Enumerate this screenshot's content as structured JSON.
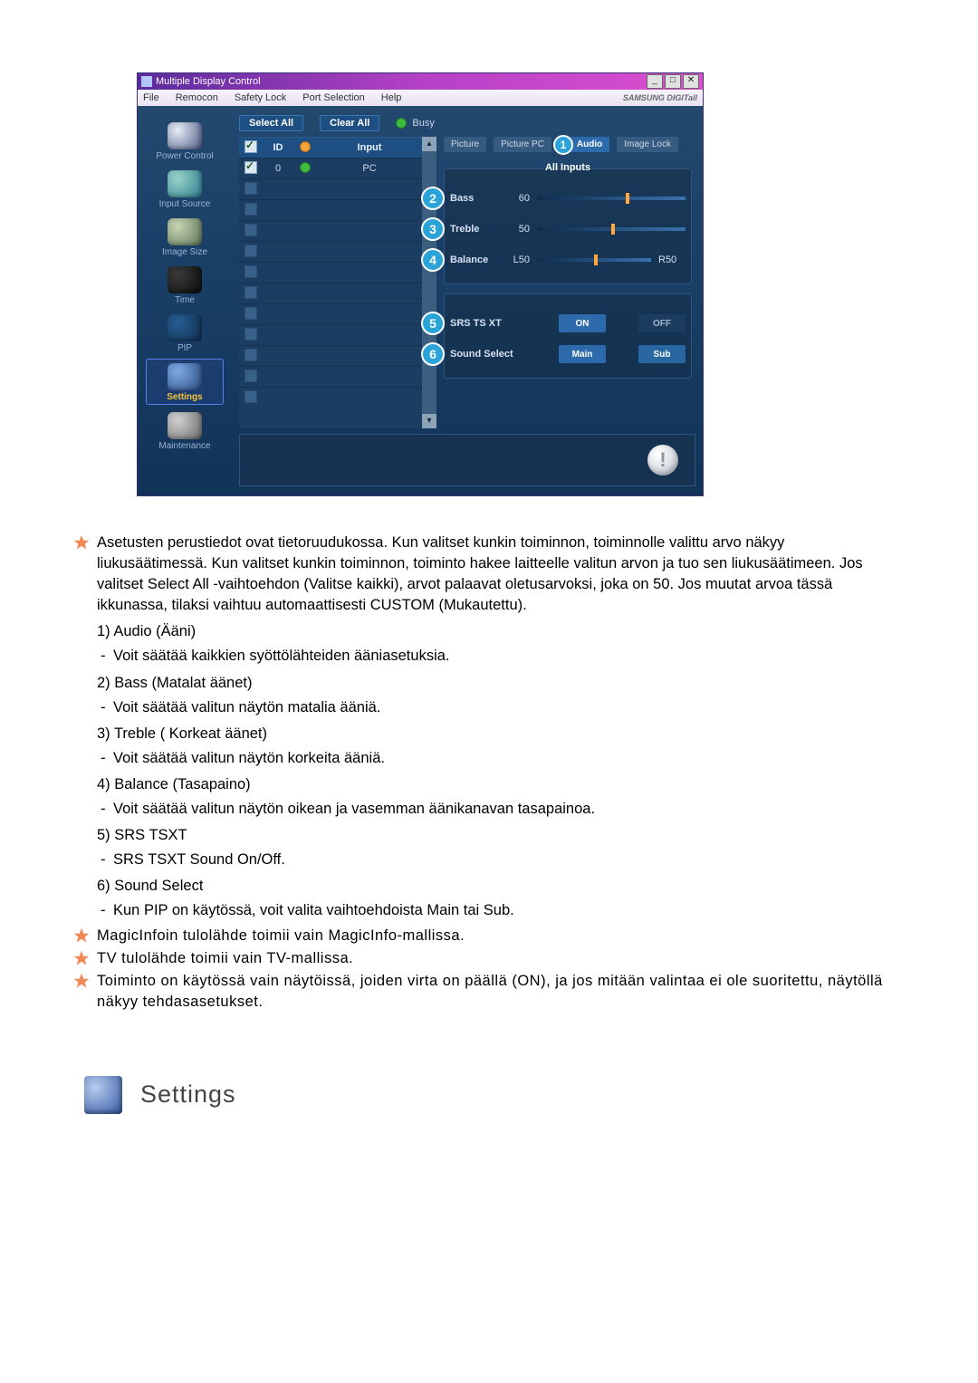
{
  "app": {
    "title": "Multiple Display Control",
    "brand": "SAMSUNG DIGITall",
    "menu": {
      "file": "File",
      "remocon": "Remocon",
      "safety_lock": "Safety Lock",
      "port_selection": "Port Selection",
      "help": "Help"
    },
    "sidebar": {
      "power_control": "Power Control",
      "input_source": "Input Source",
      "image_size": "Image Size",
      "time": "Time",
      "pip": "PIP",
      "settings": "Settings",
      "maintenance": "Maintenance"
    },
    "toolbar": {
      "select_all": "Select All",
      "clear_all": "Clear All",
      "busy": "Busy"
    },
    "table": {
      "head_id": "ID",
      "head_input": "Input",
      "rows": [
        {
          "id": "0",
          "input": "PC",
          "checked": true,
          "status_on": true
        },
        {
          "id": "",
          "input": "",
          "checked": false,
          "status_on": false
        },
        {
          "id": "",
          "input": "",
          "checked": false,
          "status_on": false
        },
        {
          "id": "",
          "input": "",
          "checked": false,
          "status_on": false
        },
        {
          "id": "",
          "input": "",
          "checked": false,
          "status_on": false
        },
        {
          "id": "",
          "input": "",
          "checked": false,
          "status_on": false
        },
        {
          "id": "",
          "input": "",
          "checked": false,
          "status_on": false
        },
        {
          "id": "",
          "input": "",
          "checked": false,
          "status_on": false
        },
        {
          "id": "",
          "input": "",
          "checked": false,
          "status_on": false
        },
        {
          "id": "",
          "input": "",
          "checked": false,
          "status_on": false
        },
        {
          "id": "",
          "input": "",
          "checked": false,
          "status_on": false
        },
        {
          "id": "",
          "input": "",
          "checked": false,
          "status_on": false
        }
      ]
    },
    "tabs": {
      "picture": "Picture",
      "picture_pc": "Picture PC",
      "audio": "Audio",
      "image_lock": "Image Lock"
    },
    "panel": {
      "all_inputs": "All Inputs",
      "bass": {
        "label": "Bass",
        "value": "60",
        "pos": 60
      },
      "treble": {
        "label": "Treble",
        "value": "50",
        "pos": 50
      },
      "balance": {
        "label": "Balance",
        "left": "L50",
        "right": "R50",
        "pos": 50
      },
      "srs": {
        "label": "SRS TS XT",
        "on": "ON",
        "off": "OFF"
      },
      "sound": {
        "label": "Sound Select",
        "main": "Main",
        "sub": "Sub"
      }
    },
    "badges": {
      "b1": "1",
      "b2": "2",
      "b3": "3",
      "b4": "4",
      "b5": "5",
      "b6": "6"
    }
  },
  "doc": {
    "p1": "Asetusten perustiedot ovat tietoruudukossa. Kun valitset kunkin toiminnon, toiminnolle valittu arvo näkyy liukusäätimessä. Kun valitset kunkin toiminnon, toiminto hakee laitteelle valitun arvon ja tuo sen liukusäätimeen. Jos valitset Select All -vaihtoehdon (Valitse kaikki), arvot palaavat oletusarvoksi, joka on 50. Jos muutat arvoa tässä ikkunassa, tilaksi vaihtuu automaattisesti CUSTOM (Mukautettu).",
    "items": {
      "i1t": "1)  Audio (Ääni)",
      "i1s": "Voit säätää kaikkien syöttölähteiden ääniasetuksia.",
      "i2t": "2)  Bass (Matalat äänet)",
      "i2s": "Voit säätää valitun näytön matalia ääniä.",
      "i3t": "3)  Treble ( Korkeat äänet)",
      "i3s": "Voit säätää valitun näytön korkeita ääniä.",
      "i4t": "4)  Balance (Tasapaino)",
      "i4s": "Voit säätää valitun näytön oikean ja vasemman äänikanavan tasapainoa.",
      "i5t": "5)  SRS TSXT",
      "i5s": "SRS TSXT Sound On/Off.",
      "i6t": "6)  Sound Select",
      "i6s": "Kun PIP on käytössä, voit valita vaihtoehdoista Main tai Sub."
    },
    "n1": "MagicInfoin tulolähde toimii vain MagicInfo-mallissa.",
    "n2": "TV tulolähde toimii vain TV-mallissa.",
    "n3": "Toiminto on käytössä vain näytöissä, joiden virta on päällä (ON), ja jos mitään valintaa ei ole suoritettu, näytöllä näkyy tehdasasetukset.",
    "heading": "Settings"
  }
}
